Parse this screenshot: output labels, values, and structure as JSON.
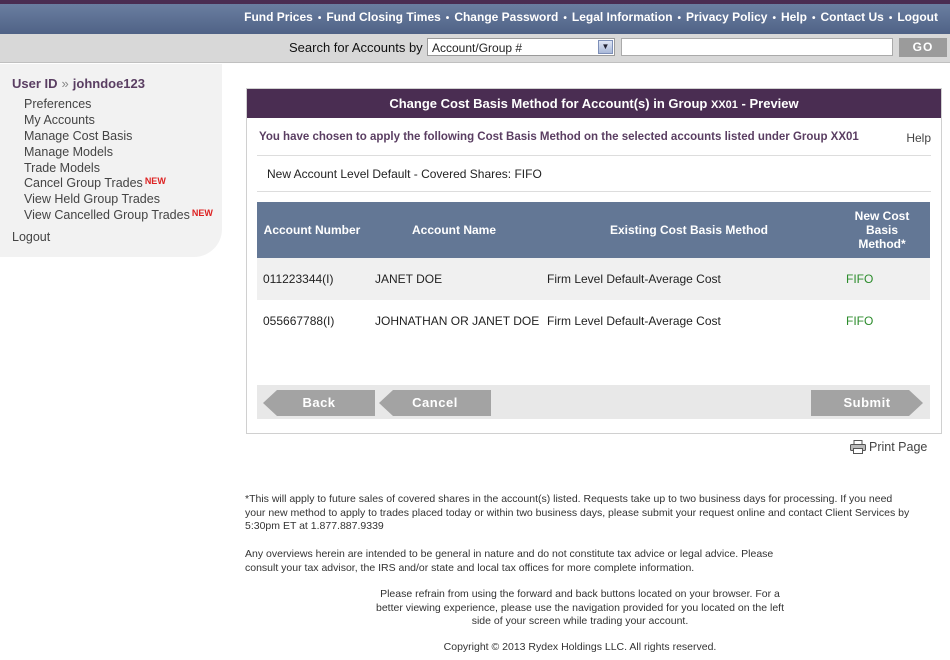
{
  "topnav": [
    "Fund Prices",
    "Fund Closing Times",
    "Change Password",
    "Legal Information",
    "Privacy Policy",
    "Help",
    "Contact Us",
    "Logout"
  ],
  "search": {
    "label": "Search for Accounts by",
    "select_value": "Account/Group #",
    "input_value": "",
    "go_label": "GO"
  },
  "sidebar": {
    "userid_label": "User ID",
    "username": "johndoe123",
    "items": [
      {
        "label": "Preferences",
        "is_new": false
      },
      {
        "label": "My Accounts",
        "is_new": false
      },
      {
        "label": "Manage Cost Basis",
        "is_new": false
      },
      {
        "label": "Manage Models",
        "is_new": false
      },
      {
        "label": "Trade Models",
        "is_new": false
      },
      {
        "label": "Cancel Group Trades",
        "is_new": true
      },
      {
        "label": "View Held Group Trades",
        "is_new": false
      },
      {
        "label": "View Cancelled Group Trades",
        "is_new": true
      }
    ],
    "new_badge": "NEW",
    "logout_label": "Logout"
  },
  "panel": {
    "title_prefix": "Change Cost Basis Method for Account(s) in Group",
    "group": "XX01",
    "title_suffix": "- Preview",
    "chosen_text": "You have chosen to apply the following Cost Basis Method on the selected accounts listed under Group XX01",
    "help_label": "Help",
    "new_default": "New Account Level Default - Covered Shares: FIFO",
    "table": {
      "headers": [
        "Account Number",
        "Account Name",
        "Existing Cost Basis Method",
        "New Cost Basis Method*"
      ],
      "rows": [
        [
          "011223344(I)",
          "JANET DOE",
          "Firm Level Default-Average Cost",
          "FIFO"
        ],
        [
          "055667788(I)",
          "JOHNATHAN OR JANET DOE",
          "Firm Level Default-Average Cost",
          "FIFO"
        ]
      ]
    },
    "buttons": {
      "back": "Back",
      "cancel": "Cancel",
      "submit": "Submit"
    }
  },
  "print_label": "Print Page",
  "footnotes": {
    "note1": "*This will apply to future sales of covered shares in the account(s) listed. Requests take up to two business days for processing. If you need your new method to apply to trades placed today or within two business days, please submit your request online and contact Client Services by 5:30pm ET at 1.877.887.9339",
    "note2": "Any overviews herein are intended to be general in nature and do not constitute tax advice or legal advice. Please consult your tax advisor, the IRS and/or state and local tax offices for more complete information.",
    "note3": "Please refrain from using the forward and back buttons located on your browser. For a better viewing experience, please use the navigation provided for you located on the left side of your screen while trading your account.",
    "copyright": "Copyright © 2013 Rydex Holdings LLC. All rights reserved."
  },
  "colors": {
    "header_purple": "#4a2d52",
    "table_header": "#637795",
    "fifo_green": "#2c8c2c",
    "new_red": "#d22222"
  }
}
